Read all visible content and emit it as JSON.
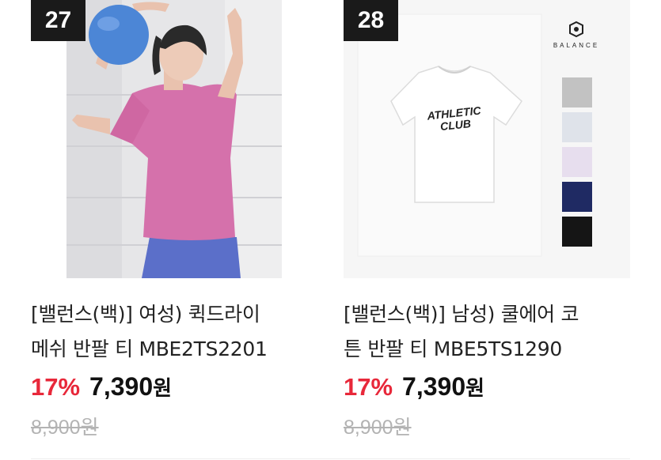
{
  "products": [
    {
      "rank": "27",
      "title_line1": "[밸런스(백)] 여성) 퀵드라이",
      "title_line2": "메쉬 반팔 티 MBE2TS2201",
      "discount": "17%",
      "price": "7,390",
      "currency": "원",
      "original_price": "8,900원",
      "image_icon": "woman-pink-tshirt-photo",
      "colors": {
        "shirt": "#d571ab",
        "leggings": "#5b72cf",
        "ball": "#4c86d6",
        "background": "#e8e8ea"
      }
    },
    {
      "rank": "28",
      "title_line1": "[밸런스(백)] 남성) 쿨에어 코",
      "title_line2": "튼 반팔 티 MBE5TS1290",
      "discount": "17%",
      "price": "7,390",
      "currency": "원",
      "original_price": "8,900원",
      "brand": "BALANCE",
      "shirt_print_line1": "ATHLETIC",
      "shirt_print_line2": "CLUB",
      "image_icon": "white-tshirt-product-photo",
      "swatches": [
        "#c2c2c2",
        "#dfe3ea",
        "#e7deee",
        "#1f2a63",
        "#151515"
      ]
    }
  ],
  "colors": {
    "discount": "#e8283a",
    "rank_bg": "#1a1a1a",
    "strike": "#b3b3b3"
  }
}
